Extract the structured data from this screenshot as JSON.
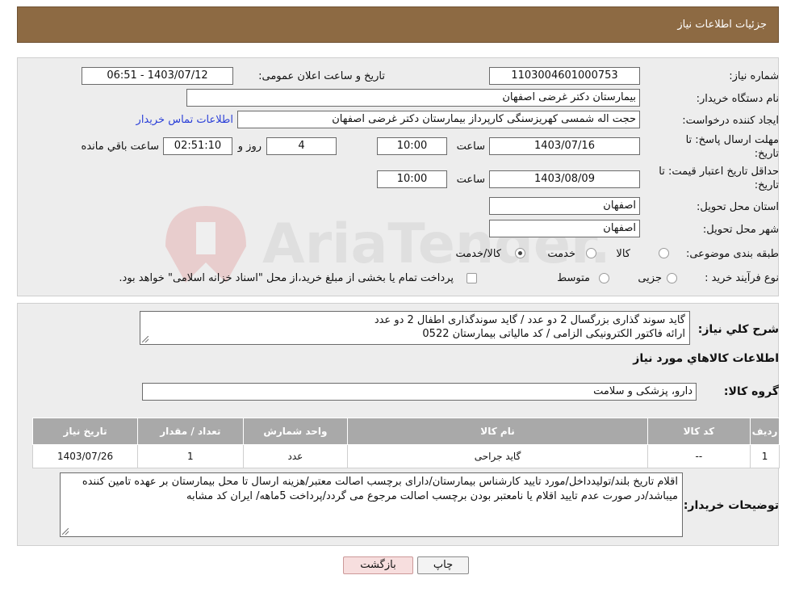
{
  "header": {
    "title": "جزئیات اطلاعات نیاز"
  },
  "fields": {
    "need_number_label": "شماره نیاز:",
    "need_number": "1103004601000753",
    "announce_label": "تاریخ و ساعت اعلان عمومی:",
    "announce_value": "1403/07/12 - 06:51",
    "buyer_org_label": "نام دستگاه خریدار:",
    "buyer_org": "بیمارستان دکتر غرضی اصفهان",
    "requester_label": "ایجاد کننده درخواست:",
    "requester": "حجت اله شمسی کهریزسنگی کارپرداز بیمارستان دکتر غرضی اصفهان",
    "contact_link": "اطلاعات تماس خریدار",
    "deadline_label_1": "مهلت ارسال پاسخ: تا",
    "deadline_label_2": "تاریخ:",
    "deadline_date": "1403/07/16",
    "time_label": "ساعت",
    "deadline_time": "10:00",
    "days_value": "4",
    "days_label": "روز و",
    "remaining_time": "02:51:10",
    "remaining_label": "ساعت باقي مانده",
    "validity_label_1": "حداقل تاریخ اعتبار قیمت: تا",
    "validity_label_2": "تاریخ:",
    "validity_date": "1403/08/09",
    "validity_time": "10:00",
    "province_label": "استان محل تحویل:",
    "province": "اصفهان",
    "city_label": "شهر محل تحویل:",
    "city": "اصفهان",
    "category_label": "طبقه بندی موضوعی:",
    "category_options": [
      "کالا",
      "خدمت",
      "کالا/خدمت"
    ],
    "purchase_type_label": "نوع فرآیند خرید :",
    "purchase_options": [
      "جزیی",
      "متوسط"
    ],
    "purchase_note": "پرداخت تمام یا بخشی از مبلغ خرید،از محل \"اسناد خزانه اسلامی\" خواهد بود."
  },
  "summary": {
    "label": "شرح کلي نياز:",
    "line1": "گاید سوند گذاری بزرگسال 2 دو عدد / گاید سوندگذاری اطفال 2 دو عدد",
    "line2": "ارائه فاکتور الکترونیکی الزامی / کد مالیاتی بیمارستان 0522",
    "goods_heading": "اطلاعات کالاهاي مورد نياز",
    "group_label": "گروه کالا:",
    "group_value": "دارو، پزشکی و سلامت"
  },
  "table": {
    "headers": [
      "ردیف",
      "کد کالا",
      "نام کالا",
      "واحد شمارش",
      "تعداد / مقدار",
      "تاریخ نیاز"
    ],
    "rows": [
      [
        "1",
        "--",
        "گاید جراحی",
        "عدد",
        "1",
        "1403/07/26"
      ]
    ]
  },
  "notes": {
    "label": "توضیحات خریدار:",
    "text": "اقلام تاریخ بلند/تولیدداخل/مورد تایید کارشناس بیمارستان/دارای برچسب اصالت معتبر/هزینه ارسال تا محل بیمارستان بر عهده تامین کننده میباشد/در صورت عدم تایید اقلام یا نامعتبر بودن برچسب اصالت مرجوع می گردد/پرداخت 5ماهه/ ایران کد مشابه"
  },
  "buttons": {
    "print": "چاپ",
    "back": "بازگشت"
  },
  "colors": {
    "header": "#8d6a43",
    "panel": "#ededed",
    "table_header": "#a9a9a9",
    "link": "#2a3fd8",
    "back_button": "#f7dede"
  }
}
